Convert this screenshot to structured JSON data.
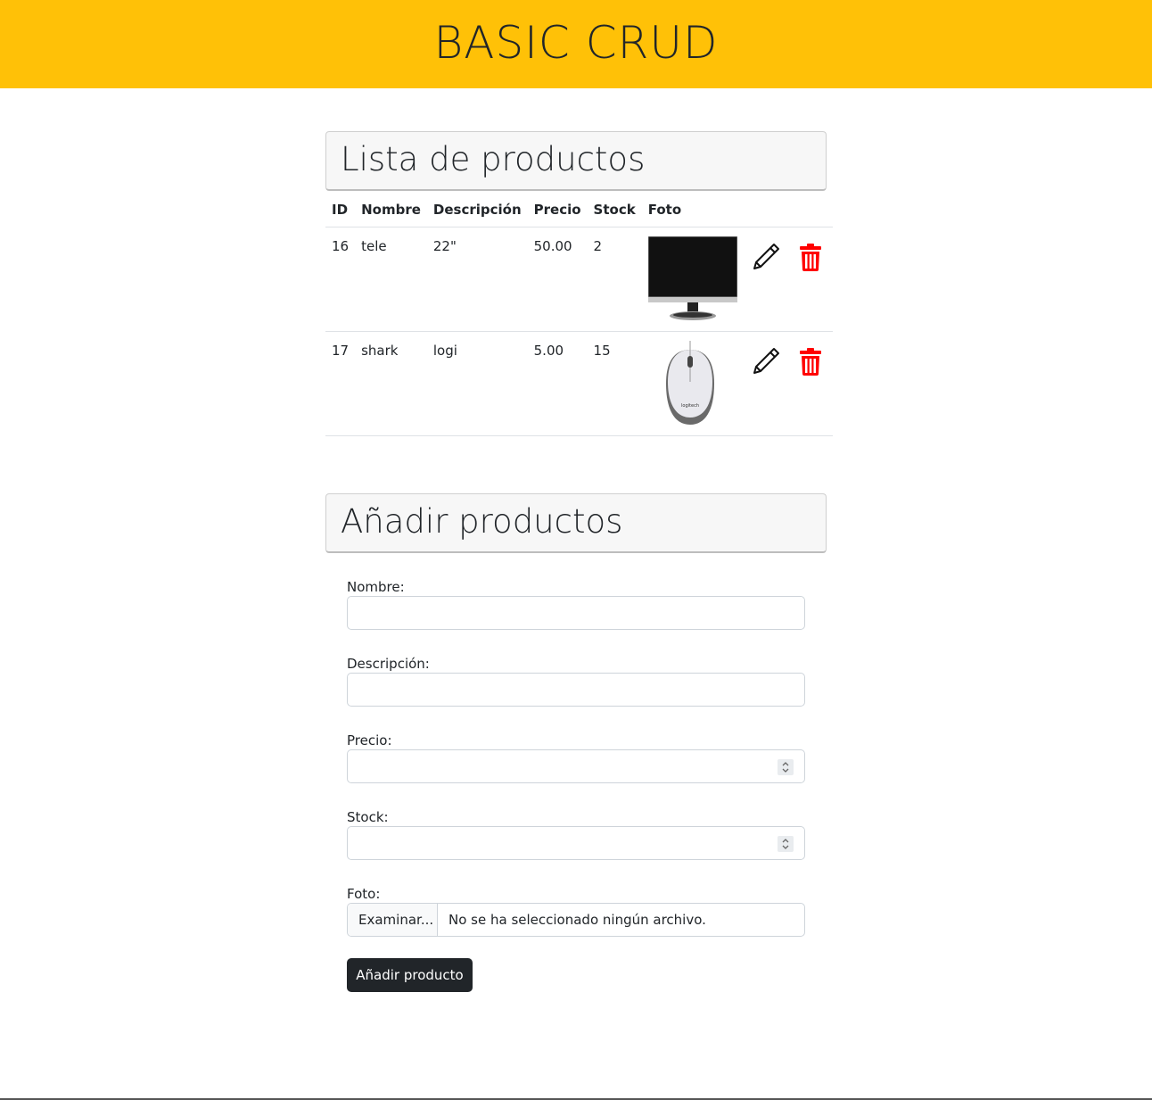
{
  "header": {
    "title": "BASIC CRUD",
    "bg_color": "#ffc107"
  },
  "list_section": {
    "title": "Lista de productos",
    "columns": [
      "ID",
      "Nombre",
      "Descripción",
      "Precio",
      "Stock",
      "Foto"
    ],
    "rows": [
      {
        "id": "16",
        "nombre": "tele",
        "descripcion": "22\"",
        "precio": "50.00",
        "stock": "2",
        "foto": "monitor-image"
      },
      {
        "id": "17",
        "nombre": "shark",
        "descripcion": "logi",
        "precio": "5.00",
        "stock": "15",
        "foto": "mouse-image",
        "mouse_brand": "logitech"
      }
    ],
    "actions": {
      "edit_icon": "pencil-icon",
      "delete_icon": "trash-icon",
      "delete_color": "#ff0000"
    }
  },
  "add_section": {
    "title": "Añadir productos",
    "fields": {
      "nombre_label": "Nombre:",
      "descripcion_label": "Descripción:",
      "precio_label": "Precio:",
      "stock_label": "Stock:",
      "foto_label": "Foto:",
      "file_button": "Examinar...",
      "file_status": "No se ha seleccionado ningún archivo."
    },
    "submit_label": "Añadir producto"
  }
}
